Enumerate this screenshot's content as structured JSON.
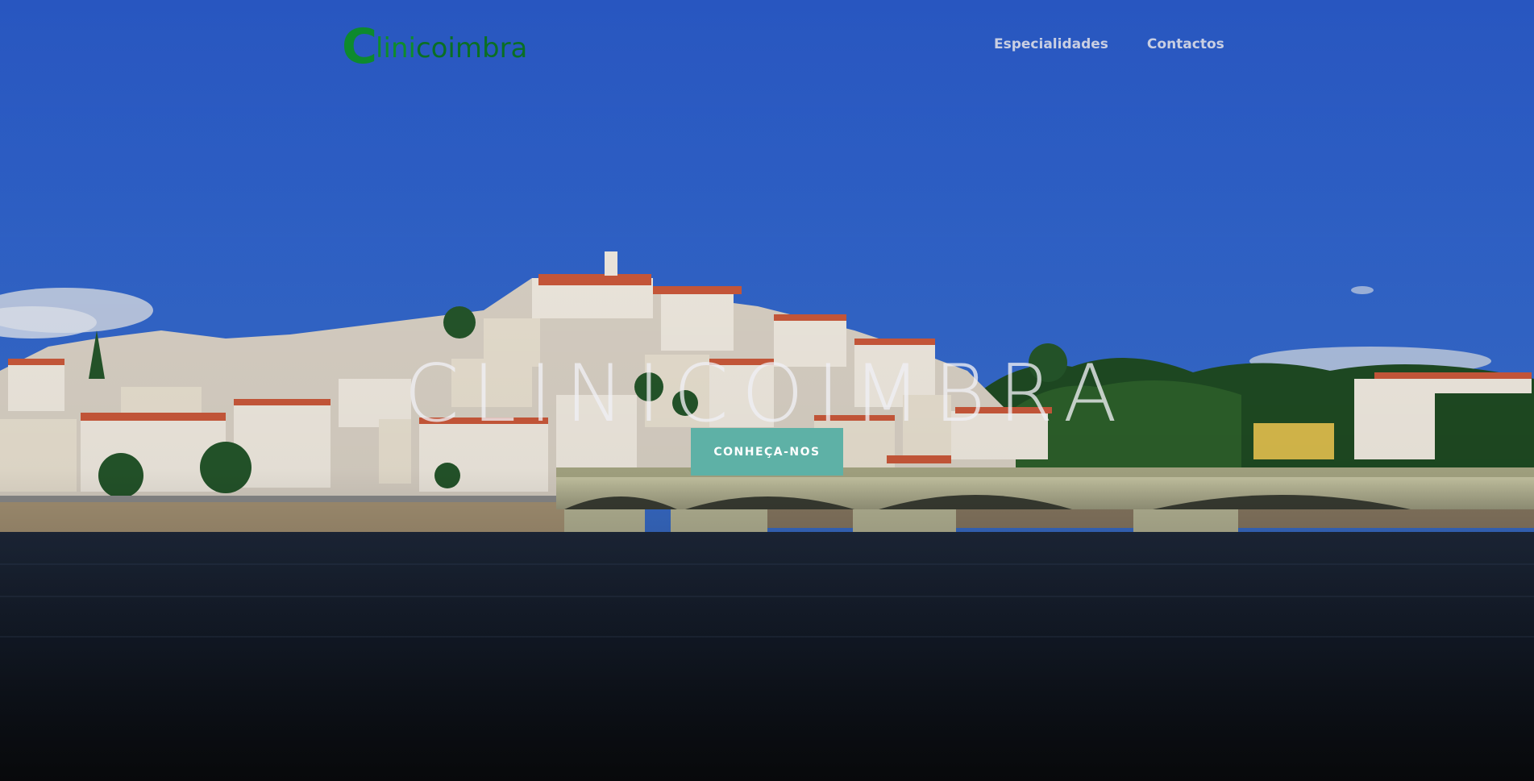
{
  "navbar": {
    "logo": {
      "initial": "C",
      "rest_part1": "lini",
      "rest_part2": "coimbra"
    },
    "links": [
      {
        "label": "Especialidades"
      },
      {
        "label": "Contactos"
      }
    ]
  },
  "hero": {
    "title": "CLINICOIMBRA",
    "cta_label": "CONHEÇA-NOS",
    "background": "coimbra-cityscape-river-bridge"
  },
  "colors": {
    "brand_green": "#0d8a2e",
    "cta_teal": "#5eb1a6",
    "sky_blue": "#2b5bc4",
    "nav_text": "#c9cfe2"
  }
}
